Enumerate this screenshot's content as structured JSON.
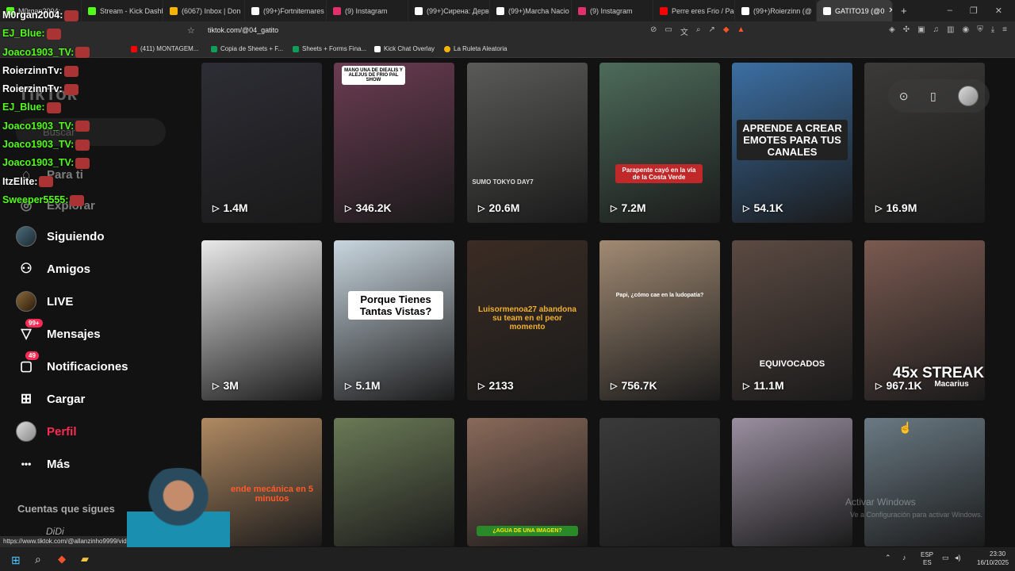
{
  "browser": {
    "tabs": [
      {
        "label": "M0rgan2004:",
        "color": "#53fc18"
      },
      {
        "label": "Stream - Kick Dashb",
        "color": "#53fc18"
      },
      {
        "label": "(6067) Inbox | Don",
        "color": "#f4b400"
      },
      {
        "label": "(99+)Fortnitemares",
        "color": "#ffffff"
      },
      {
        "label": "(9) Instagram",
        "color": "#e1306c"
      },
      {
        "label": "(99+)Сирена: Дерв",
        "color": "#ffffff"
      },
      {
        "label": "(99+)Marcha Nacio",
        "color": "#ffffff"
      },
      {
        "label": "(9) Instagram",
        "color": "#e1306c"
      },
      {
        "label": "Perre eres Frio / Pa",
        "color": "#ff0000"
      },
      {
        "label": "(99+)Roierzinn (@",
        "color": "#ffffff"
      }
    ],
    "active_tab": "GATITO19 (@0",
    "new_tab": "+",
    "window_controls": [
      "–",
      "❐",
      "✕"
    ],
    "url": "tiktok.com/@04_gatito",
    "bookmarks": [
      {
        "label": "(411) MONTAGEM...",
        "color": "#ff0000"
      },
      {
        "label": "Copia de Sheets + F...",
        "color": "#0f9d58"
      },
      {
        "label": "Sheets + Forms Fina...",
        "color": "#0f9d58"
      },
      {
        "label": "Kick Chat Overlay",
        "color": "#ffffff"
      },
      {
        "label": "La Ruleta Aleatoria",
        "color": "#f4b400"
      }
    ],
    "status_url": "https://www.tiktok.com/@allanzinho9999/vide"
  },
  "chat_overlay": [
    {
      "user": "M0rgan2004:",
      "color": "#ffffff"
    },
    {
      "user": "EJ_Blue:",
      "color": "#53fc18"
    },
    {
      "user": "Joaco1903_TV:",
      "color": "#53fc18"
    },
    {
      "user": "RoierzinnTv:",
      "color": "#ffffff"
    },
    {
      "user": "RoierzinnTv:",
      "color": "#ffffff"
    },
    {
      "user": "EJ_Blue:",
      "color": "#53fc18"
    },
    {
      "user": "Joaco1903_TV:",
      "color": "#53fc18"
    },
    {
      "user": "Joaco1903_TV:",
      "color": "#53fc18"
    },
    {
      "user": "Joaco1903_TV:",
      "color": "#53fc18"
    },
    {
      "user": "ItzElite:",
      "color": "#ffffff"
    },
    {
      "user": "Sweeper5555:",
      "color": "#53fc18"
    }
  ],
  "sidebar": {
    "logo": "TikTok",
    "search_placeholder": "Buscar",
    "items": [
      {
        "label": "Para ti",
        "icon": "home-icon"
      },
      {
        "label": "Explorar",
        "icon": "compass-icon"
      },
      {
        "label": "Siguiendo",
        "icon": "avatar"
      },
      {
        "label": "Amigos",
        "icon": "friends-icon"
      },
      {
        "label": "LIVE",
        "icon": "live-icon"
      },
      {
        "label": "Mensajes",
        "icon": "message-icon",
        "badge": "99+"
      },
      {
        "label": "Notificaciones",
        "icon": "bell-icon",
        "badge": "49"
      },
      {
        "label": "Cargar",
        "icon": "plus-icon"
      },
      {
        "label": "Perfil",
        "icon": "avatar"
      },
      {
        "label": "Más",
        "icon": "more-icon"
      }
    ],
    "following_title": "Cuentas que sigues",
    "followed_account": "DiDi"
  },
  "videos": [
    {
      "views": "1.4M",
      "bg": "#2d2d35",
      "overlay": ""
    },
    {
      "views": "346.2K",
      "bg": "#6b3c52",
      "overlay": "MANO UNA DE DIEALIS Y ALEJUS DE FRIO PAL SHOW"
    },
    {
      "views": "20.6M",
      "bg": "#5a5a58",
      "overlay": "SUMO TOKYO DAY7"
    },
    {
      "views": "7.2M",
      "bg": "#4d6b5a",
      "overlay": "Parapente cayó en la vía de la Costa Verde"
    },
    {
      "views": "54.1K",
      "bg": "#3b6fa3",
      "overlay": "APRENDE A CREAR EMOTES PARA TUS CANALES"
    },
    {
      "views": "16.9M",
      "bg": "#3c3a38",
      "overlay": ""
    },
    {
      "views": "3M",
      "bg": "#e9e9e9",
      "overlay": ""
    },
    {
      "views": "5.1M",
      "bg": "#c9d6df",
      "overlay": "Porque Tienes Tantas Vistas?"
    },
    {
      "views": "2133",
      "bg": "#3a2c24",
      "overlay": "Luisormenoa27 abandona su team en el peor momento"
    },
    {
      "views": "756.7K",
      "bg": "#a18a73",
      "overlay": "Papi, ¿cómo cae en la ludopatía?"
    },
    {
      "views": "11.1M",
      "bg": "#5b4a42",
      "overlay": "EQUIVOCADOS"
    },
    {
      "views": "967.1K",
      "bg": "#7a5a50",
      "overlay": "Macarius"
    },
    {
      "views": "",
      "bg": "#b08a62",
      "overlay": "ende mecánica en 5 minutos"
    },
    {
      "views": "",
      "bg": "#6b7a56",
      "overlay": ""
    },
    {
      "views": "",
      "bg": "#8a6a5a",
      "overlay": "¿AGUA DE UNA IMAGEN?"
    },
    {
      "views": "",
      "bg": "#3a3a3a",
      "overlay": ""
    },
    {
      "views": "",
      "bg": "#9a8fa0",
      "overlay": ""
    },
    {
      "views": "",
      "bg": "#6a7a84",
      "overlay": ""
    }
  ],
  "streak_text": "45x STREAK",
  "watermark": {
    "title": "Activar Windows",
    "subtitle": "Ve a Configuración para activar Windows."
  },
  "taskbar": {
    "lang": "ESP",
    "lang2": "ES",
    "time": "23:30",
    "date": "16/10/2025"
  }
}
